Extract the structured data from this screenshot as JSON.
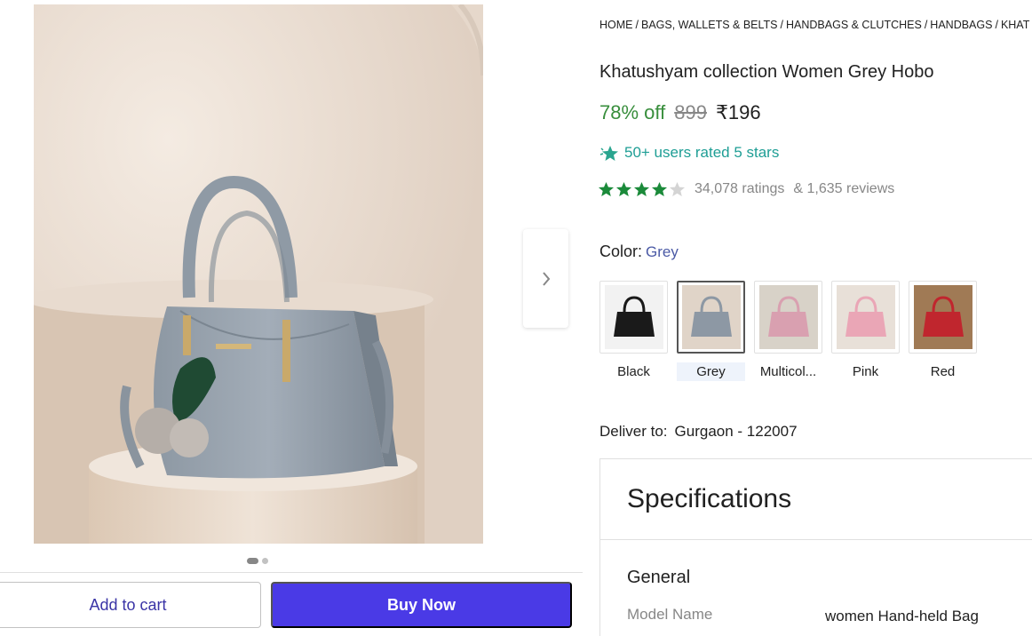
{
  "breadcrumb": [
    "HOME",
    "BAGS, WALLETS & BELTS",
    "HANDBAGS & CLUTCHES",
    "HANDBAGS",
    "KHAT"
  ],
  "product": {
    "title": "Khatushyam collection Women Grey Hobo",
    "discount": "78% off",
    "mrp": "899",
    "price": "₹196",
    "users_rated": "50+ users rated 5 stars",
    "rating_value": 4,
    "rating_max": 5,
    "ratings_count": "34,078 ratings",
    "reviews_count": "& 1,635 reviews"
  },
  "color": {
    "label": "Color:",
    "selected": "Grey",
    "options": [
      {
        "name": "Black",
        "swatch": "#1a1a1a",
        "bg": "#f2f2f2"
      },
      {
        "name": "Grey",
        "swatch": "#8d98a4",
        "bg": "#e0d4c8"
      },
      {
        "name": "Multicol...",
        "swatch": "#d9a0b0",
        "bg": "#d8d2c8"
      },
      {
        "name": "Pink",
        "swatch": "#eaa6b6",
        "bg": "#e8e0d8"
      },
      {
        "name": "Red",
        "swatch": "#c0262e",
        "bg": "#a07a55"
      }
    ]
  },
  "delivery": {
    "label": "Deliver to:",
    "location": "Gurgaon - 122007"
  },
  "specifications": {
    "title": "Specifications",
    "section": "General",
    "rows": [
      {
        "key": "Model Name",
        "value": "women Hand-held Bag"
      }
    ]
  },
  "actions": {
    "add_to_cart": "Add to cart",
    "buy_now": "Buy Now"
  },
  "gallery": {
    "image_count": 2,
    "active_index": 0
  },
  "colors": {
    "accent": "#4a3ae6",
    "discount_green": "#388e3c",
    "star_green": "#1b8a3a"
  }
}
